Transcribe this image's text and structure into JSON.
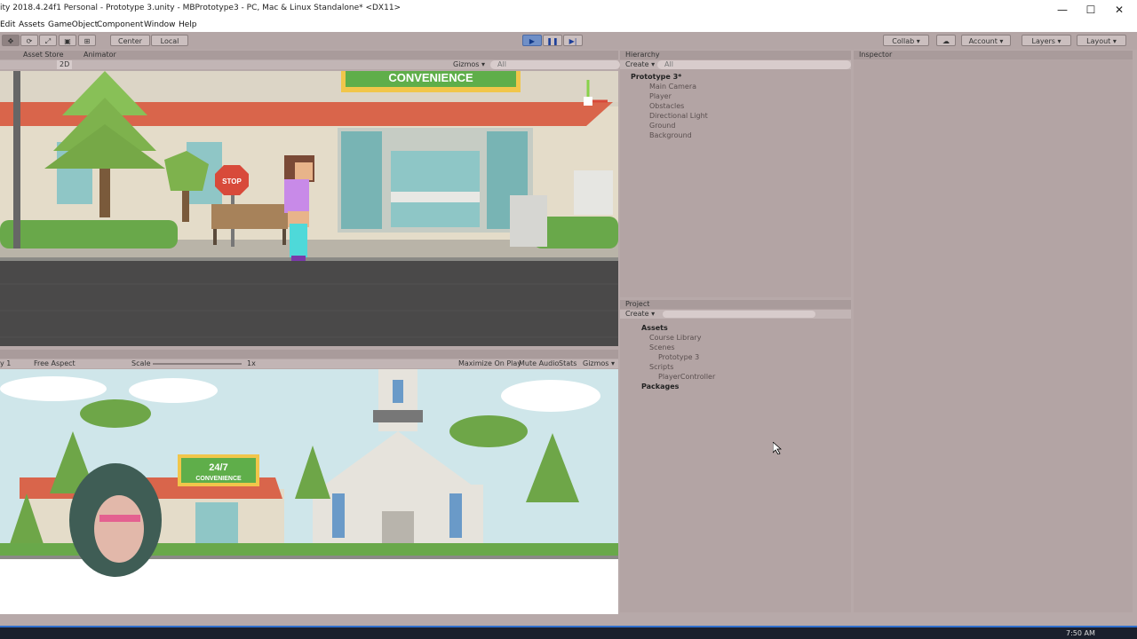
{
  "window": {
    "title": "ity 2018.4.24f1 Personal - Prototype 3.unity - MBPrototype3 - PC, Mac & Linux Standalone* <DX11>",
    "minimize": "—",
    "maximize": "☐",
    "close": "✕"
  },
  "menu": [
    "Edit",
    "Assets",
    "GameObject",
    "Component",
    "Window",
    "Help"
  ],
  "toolbar": {
    "pivot_center": "Center",
    "pivot_local": "Local",
    "collab": "Collab ▾",
    "account": "Account ▾",
    "layers": "Layers ▾",
    "layout": "Layout ▾"
  },
  "scene_tabs": [
    "Asset Store",
    "Animator"
  ],
  "scene_bar": {
    "mode_2d": "2D",
    "gizmos": "Gizmos ▾",
    "search": "All"
  },
  "game_bar": {
    "display": "y 1",
    "aspect": "Free Aspect",
    "scale_label": "Scale",
    "scale_value": "1x",
    "maximize_on_play": "Maximize On Play",
    "mute_audio": "Mute Audio",
    "stats": "Stats",
    "gizmos": "Gizmos ▾"
  },
  "hierarchy": {
    "tab": "Hierarchy",
    "create": "Create ▾",
    "search_placeholder": "All",
    "scene_name": "Prototype 3*",
    "items": [
      "Main Camera",
      "Player",
      "Obstacles",
      "Directional Light",
      "Ground",
      "Background"
    ]
  },
  "project": {
    "tab": "Project",
    "create": "Create ▾",
    "items": [
      "Assets",
      "Course Library",
      "Scenes",
      "Prototype 3",
      "Scripts",
      "PlayerController",
      "Packages"
    ]
  },
  "inspector": {
    "tab": "Inspector"
  },
  "scene_art": {
    "store_sign": "CONVENIENCE",
    "stop_sign": "STOP"
  },
  "game_art": {
    "store_sign_top": "24/7",
    "store_sign_bottom": "CONVENIENCE"
  },
  "taskbar": {
    "clock": "7:50 AM"
  },
  "colors": {
    "accent": "#4a6aa6",
    "editor_bg": "#b3a4a4",
    "sky": "#cfe6ea",
    "awning": "#d9654b"
  }
}
